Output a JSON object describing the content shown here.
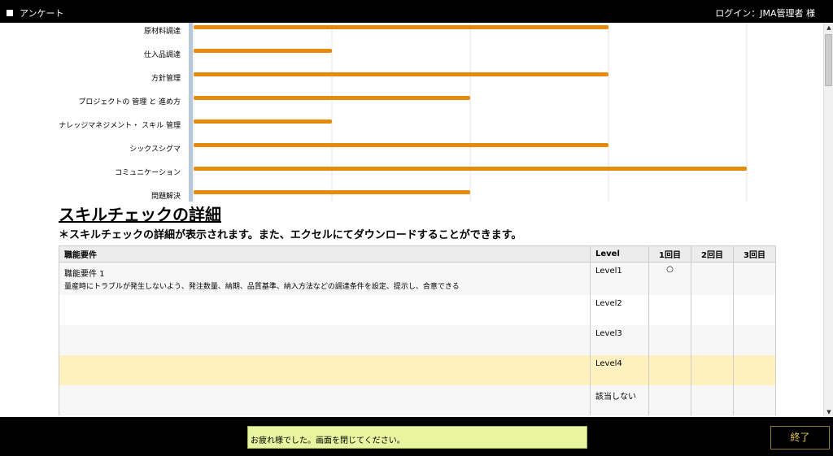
{
  "window": {
    "title": "アンケート",
    "login_text": "ログイン：JMA管理者 様"
  },
  "chart_data": {
    "type": "bar",
    "orientation": "horizontal",
    "categories": [
      "原材料調達",
      "仕入品調達",
      "方針管理",
      "プロジェクトの 管理 と 進め方",
      "ナレッジマネジメント・ スキル 管理",
      "シックスシグマ",
      "コミュニケーション",
      "問題解決"
    ],
    "values": [
      3,
      1,
      3,
      2,
      1,
      3,
      4,
      2
    ],
    "xlim": [
      0,
      4
    ],
    "grid": true,
    "bar_color": "#e58a0b"
  },
  "detail": {
    "title": "スキルチェックの詳細",
    "description": "＊スキルチェックの詳細が表示されます。また、エクセルにてダウンロードすることができます。",
    "headers": {
      "requirement": "職能要件",
      "level": "Level",
      "round1": "1回目",
      "round2": "2回目",
      "round3": "3回目"
    },
    "rows": [
      {
        "req_name": "職能要件 1",
        "req_desc": "量産時にトラブルが発生しないよう、発注数量、納期、品質基準、納入方法などの調達条件を設定、提示し、合意できる",
        "level": "Level1",
        "r1": "○",
        "r2": "",
        "r3": ""
      },
      {
        "req_name": "",
        "req_desc": "",
        "level": "Level2",
        "r1": "",
        "r2": "",
        "r3": ""
      },
      {
        "req_name": "",
        "req_desc": "",
        "level": "Level3",
        "r1": "",
        "r2": "",
        "r3": ""
      },
      {
        "req_name": "",
        "req_desc": "",
        "level": "Level4",
        "r1": "",
        "r2": "",
        "r3": ""
      },
      {
        "req_name": "",
        "req_desc": "",
        "level": "該当しない",
        "r1": "",
        "r2": "",
        "r3": ""
      }
    ]
  },
  "footer": {
    "status_message": "お疲れ様でした。画面を閉じてください。",
    "end_label": "終了"
  }
}
